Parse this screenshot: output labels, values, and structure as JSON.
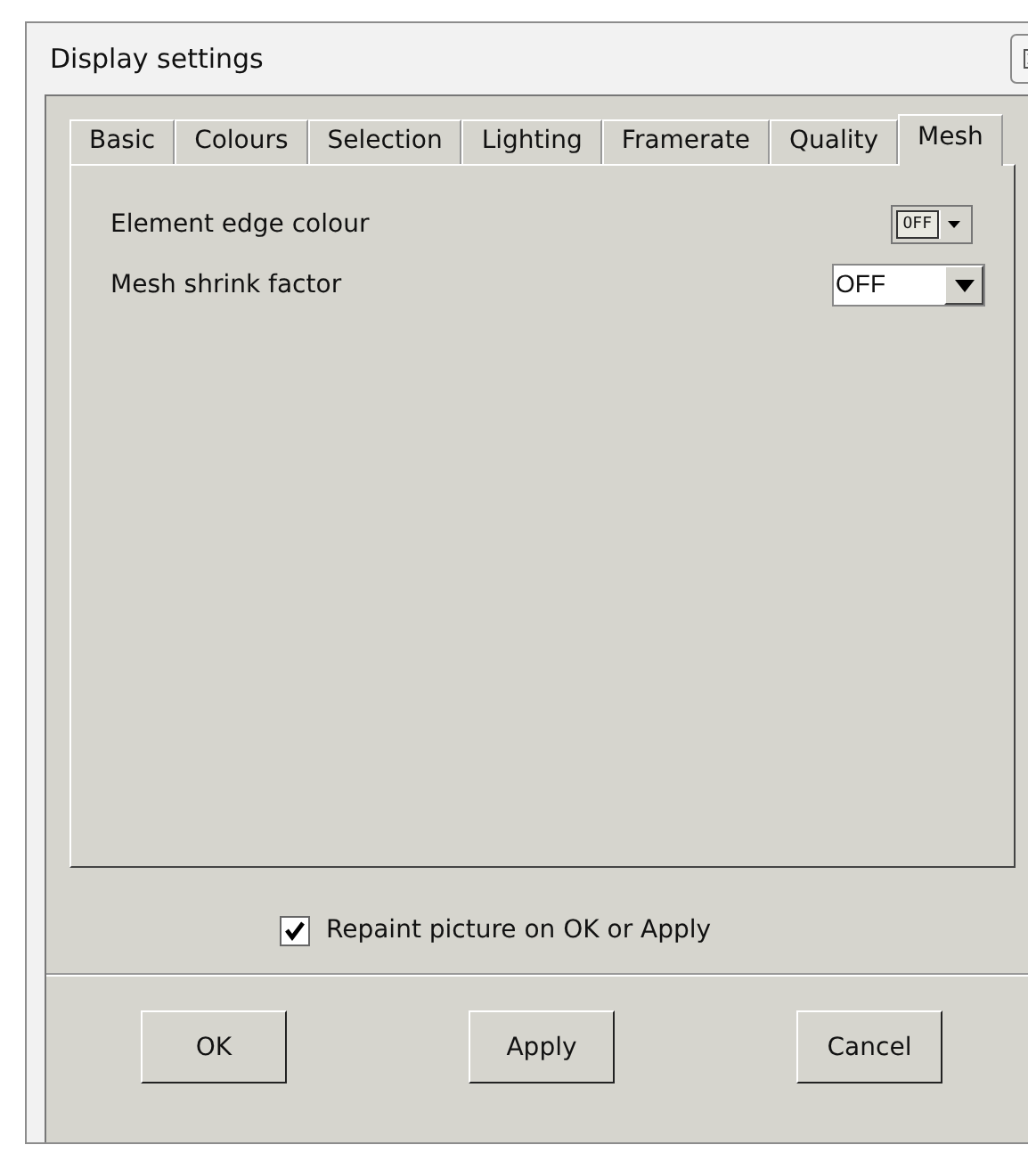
{
  "window": {
    "title": "Display settings"
  },
  "tabs": [
    {
      "label": "Basic",
      "selected": false
    },
    {
      "label": "Colours",
      "selected": false
    },
    {
      "label": "Selection",
      "selected": false
    },
    {
      "label": "Lighting",
      "selected": false
    },
    {
      "label": "Framerate",
      "selected": false
    },
    {
      "label": "Quality",
      "selected": false
    },
    {
      "label": "Mesh",
      "selected": true
    }
  ],
  "settings": [
    {
      "label": "Element edge colour",
      "kind": "colour",
      "value": "OFF"
    },
    {
      "label": "Mesh shrink factor",
      "kind": "dropdown",
      "value": "OFF"
    }
  ],
  "repaint": {
    "label": "Repaint picture on OK or Apply",
    "checked": true
  },
  "buttons": [
    "OK",
    "Apply",
    "Cancel"
  ]
}
